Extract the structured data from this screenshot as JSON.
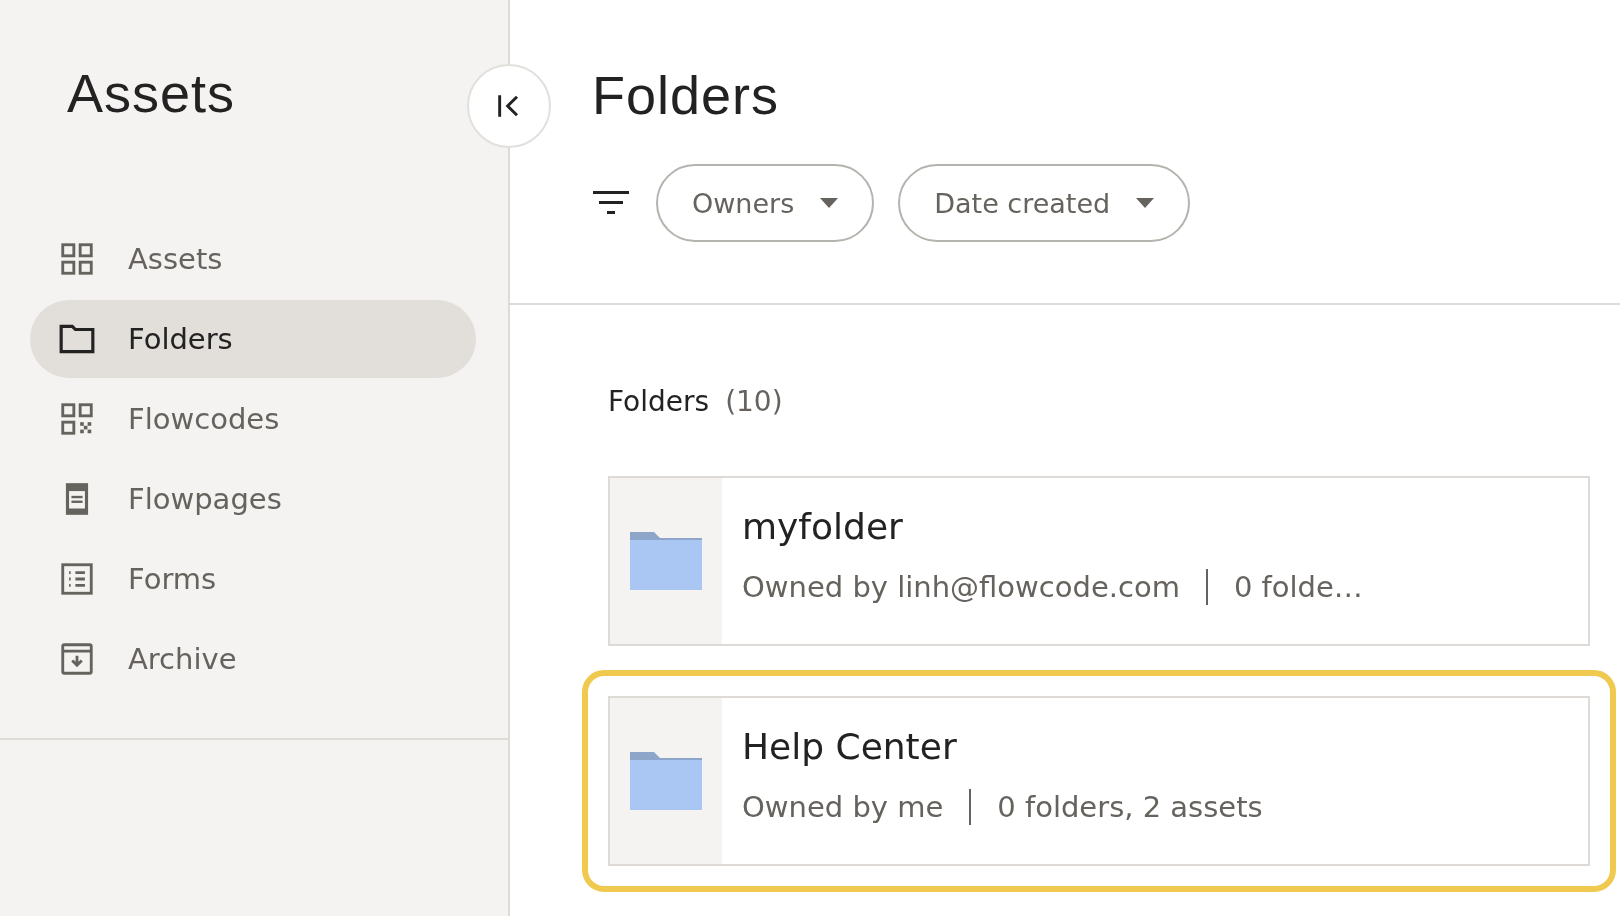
{
  "sidebar": {
    "title": "Assets",
    "items": [
      {
        "kind": "grid",
        "label": "Assets",
        "selected": false
      },
      {
        "kind": "folder",
        "label": "Folders",
        "selected": true
      },
      {
        "kind": "qr",
        "label": "Flowcodes",
        "selected": false
      },
      {
        "kind": "page",
        "label": "Flowpages",
        "selected": false
      },
      {
        "kind": "list",
        "label": "Forms",
        "selected": false
      },
      {
        "kind": "archive",
        "label": "Archive",
        "selected": false
      }
    ]
  },
  "main": {
    "title": "Folders",
    "filters": [
      "Owners",
      "Date created"
    ],
    "section": {
      "label": "Folders",
      "count": "(10)"
    },
    "folders": [
      {
        "name": "myfolder",
        "owner": "Owned by linh@flowcode.com",
        "contents": "0 folde…",
        "highlighted": false
      },
      {
        "name": "Help Center",
        "owner": "Owned by me",
        "contents": "0 folders, 2 assets",
        "highlighted": true
      }
    ]
  }
}
